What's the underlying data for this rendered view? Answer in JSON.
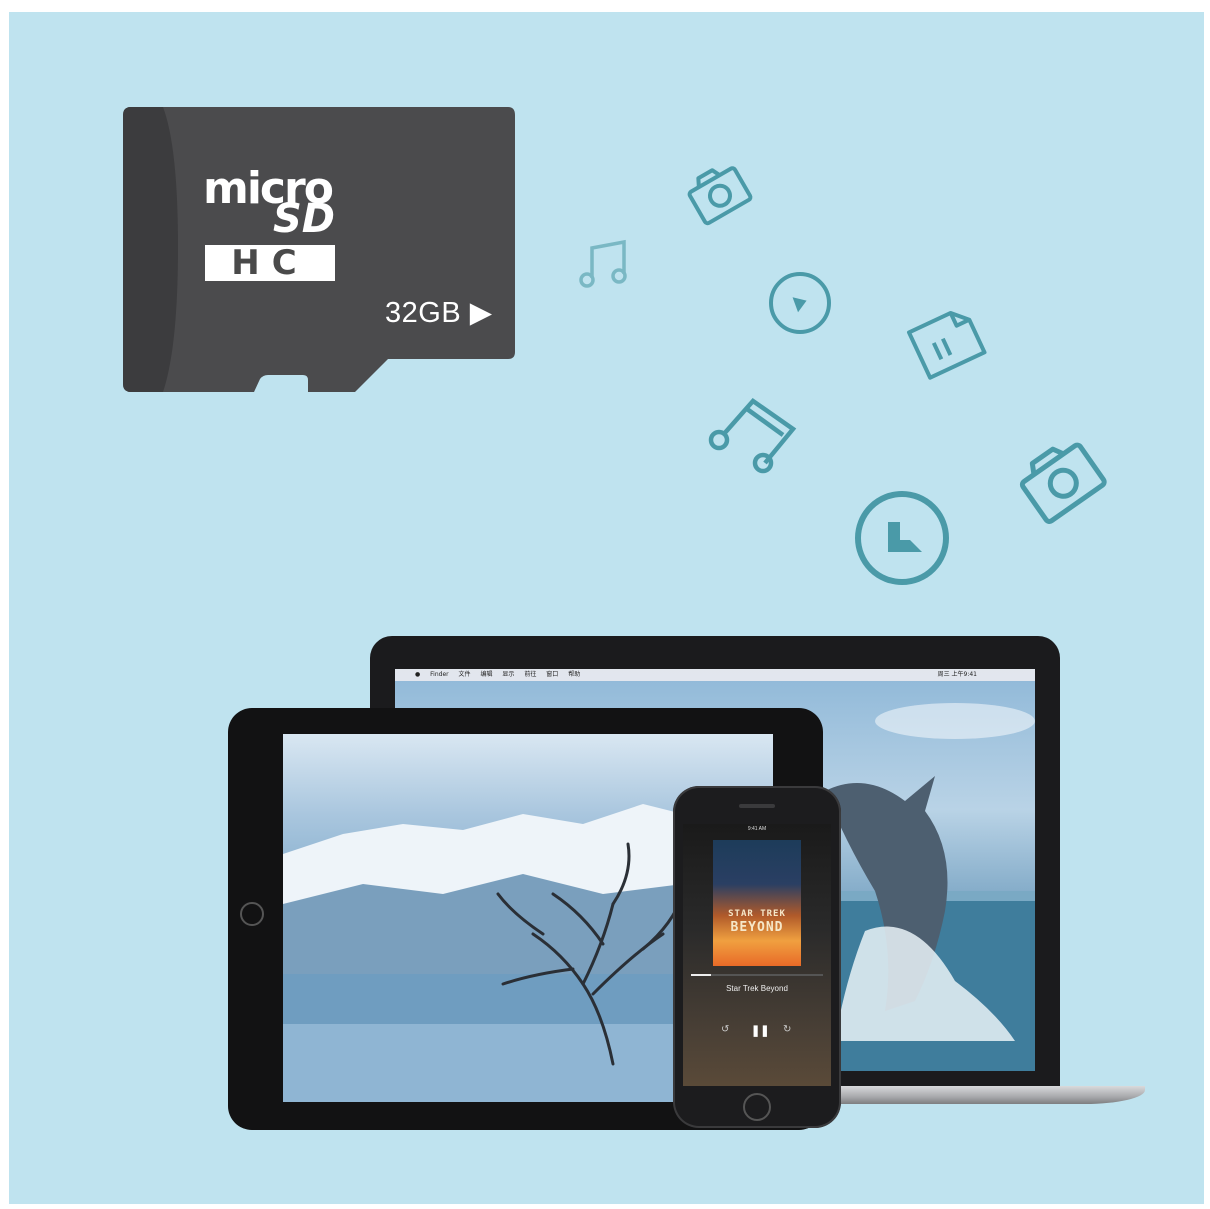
{
  "card": {
    "brand_top": "micro",
    "brand_mid": "SD",
    "brand_bottom": "HC",
    "capacity": "32GB"
  },
  "icons": [
    "camera-icon",
    "music-note-icon",
    "play-icon",
    "document-icon",
    "music-notes-icon",
    "camera-icon",
    "play-icon"
  ],
  "laptop": {
    "menubar": [
      "Finder",
      "文件",
      "编辑",
      "显示",
      "前往",
      "窗口",
      "帮助"
    ],
    "clock": "周三 上午9:41"
  },
  "phone": {
    "status_time": "9:41 AM",
    "album_title_line1": "STAR TREK",
    "album_title_line2": "BEYOND",
    "song_title": "Star Trek Beyond",
    "progress": 0.15
  },
  "colors": {
    "background": "#bfe3ef",
    "icon_stroke": "#4a9aa8",
    "card": "#4a4a4a"
  }
}
